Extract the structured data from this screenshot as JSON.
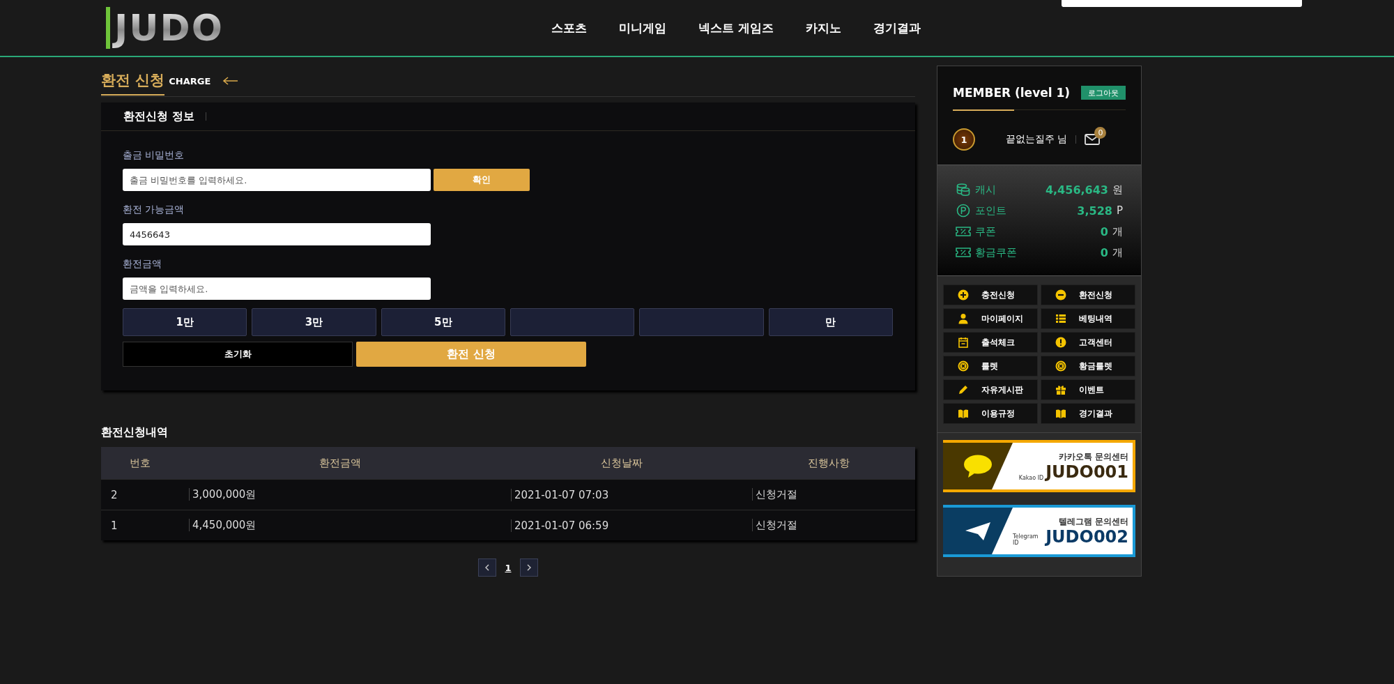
{
  "header": {
    "logo": "JUDO",
    "nav": [
      "스포츠",
      "미니게임",
      "넥스트 게임즈",
      "카지노",
      "경기결과"
    ]
  },
  "page_title": {
    "title": "환전 신청",
    "subtitle": "CHARGE"
  },
  "form": {
    "heading": "환전신청 정보",
    "password": {
      "label": "출금 비밀번호",
      "placeholder": "출금 비밀번호를 입력하세요.",
      "button": "확인"
    },
    "available": {
      "label": "환전 가능금액",
      "value": "4456643"
    },
    "amount": {
      "label": "환전금액",
      "placeholder": "금액을 입력하세요."
    },
    "amount_buttons": [
      {
        "kind": "text",
        "label": "1만"
      },
      {
        "kind": "text",
        "label": "3만"
      },
      {
        "kind": "text",
        "label": "5만"
      },
      {
        "kind": "blank"
      },
      {
        "kind": "blank"
      },
      {
        "kind": "text",
        "label": "만"
      }
    ],
    "reset_button": "초기화",
    "submit_button": "환전 신청"
  },
  "history": {
    "title": "환전신청내역",
    "columns": [
      "번호",
      "환전금액",
      "신청날짜",
      "진행사항"
    ],
    "rows": [
      [
        "2",
        "3,000,000원",
        "2021-01-07 07:03",
        "신청거절"
      ],
      [
        "1",
        "4,450,000원",
        "2021-01-07 06:59",
        "신청거절"
      ]
    ],
    "pages": [
      {
        "label": "1",
        "selected": true
      }
    ]
  },
  "sidebar": {
    "title": "MEMBER (level 1)",
    "logout": "로그아웃",
    "level_badge": "1",
    "username": "끝없는질주 님",
    "messages": "0",
    "balances": [
      {
        "kind": "cash",
        "label": "캐시",
        "value": "4,456,643",
        "unit": "원"
      },
      {
        "kind": "point",
        "label": "포인트",
        "value": "3,528",
        "unit": "P"
      },
      {
        "kind": "coupon",
        "label": "쿠폰",
        "value": "0",
        "unit": "개"
      },
      {
        "kind": "coupon",
        "label": "황금쿠폰",
        "value": "0",
        "unit": "개"
      }
    ],
    "menu": [
      {
        "kind": "plus",
        "label": "충전신청"
      },
      {
        "kind": "minus",
        "label": "환전신청"
      },
      {
        "kind": "user",
        "label": "마이페이지"
      },
      {
        "kind": "list",
        "label": "베팅내역"
      },
      {
        "kind": "calendar",
        "label": "출석체크"
      },
      {
        "kind": "alert",
        "label": "고객센터"
      },
      {
        "kind": "wheel",
        "label": "룰렛"
      },
      {
        "kind": "wheel",
        "label": "황금룰렛"
      },
      {
        "kind": "pencil",
        "label": "자유게시판"
      },
      {
        "kind": "gift",
        "label": "이벤트"
      },
      {
        "kind": "book",
        "label": "이용규정"
      },
      {
        "kind": "book",
        "label": "경기결과"
      }
    ],
    "banners": [
      {
        "kind": "kakao",
        "title": "카카오톡 문의센터",
        "id_label": "Kakao ID",
        "id": "JUDO001"
      },
      {
        "kind": "telegram",
        "title": "텔레그램 문의센터",
        "id_label": "Telegram ID",
        "id": "JUDO002"
      }
    ]
  }
}
